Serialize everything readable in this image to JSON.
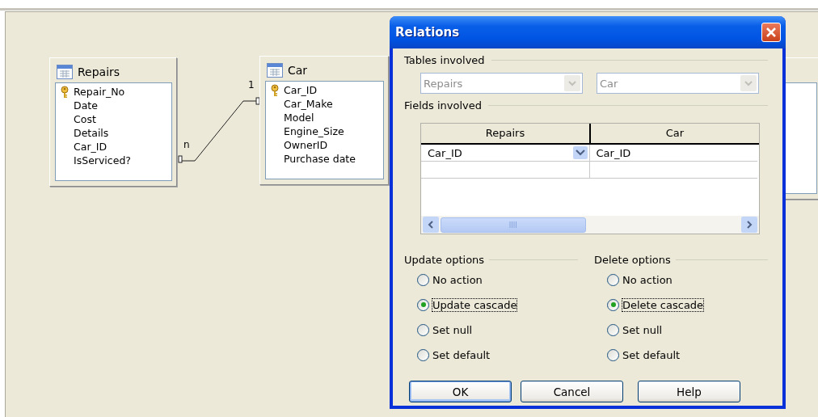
{
  "tables": [
    {
      "name": "Repairs",
      "fields": [
        {
          "name": "Repair_No",
          "key": true
        },
        {
          "name": "Date",
          "key": false
        },
        {
          "name": "Cost",
          "key": false
        },
        {
          "name": "Details",
          "key": false
        },
        {
          "name": "Car_ID",
          "key": false
        },
        {
          "name": "IsServiced?",
          "key": false
        }
      ]
    },
    {
      "name": "Car",
      "fields": [
        {
          "name": "Car_ID",
          "key": true
        },
        {
          "name": "Car_Make",
          "key": false
        },
        {
          "name": "Model",
          "key": false
        },
        {
          "name": "Engine_Size",
          "key": false
        },
        {
          "name": "OwnerID",
          "key": false
        },
        {
          "name": "Purchase date",
          "key": false
        }
      ]
    }
  ],
  "relation": {
    "many_label": "n",
    "one_label": "1"
  },
  "dialog": {
    "title": "Relations",
    "tables_involved": {
      "label": "Tables involved",
      "combos": [
        {
          "value": "Repairs",
          "disabled": true
        },
        {
          "value": "Car",
          "disabled": true
        }
      ]
    },
    "fields_involved": {
      "label": "Fields involved",
      "columns": [
        "Repairs",
        "Car"
      ],
      "rows": [
        [
          "Car_ID",
          "Car_ID"
        ]
      ]
    },
    "update_options": {
      "label": "Update options",
      "options": [
        {
          "label": "No action",
          "selected": false
        },
        {
          "label": "Update cascade",
          "selected": true
        },
        {
          "label": "Set null",
          "selected": false
        },
        {
          "label": "Set default",
          "selected": false
        }
      ]
    },
    "delete_options": {
      "label": "Delete options",
      "options": [
        {
          "label": "No action",
          "selected": false
        },
        {
          "label": "Delete cascade",
          "selected": true
        },
        {
          "label": "Set null",
          "selected": false
        },
        {
          "label": "Set default",
          "selected": false
        }
      ]
    },
    "buttons": [
      {
        "label": "OK",
        "default": true
      },
      {
        "label": "Cancel",
        "default": false
      },
      {
        "label": "Help",
        "default": false
      }
    ]
  }
}
